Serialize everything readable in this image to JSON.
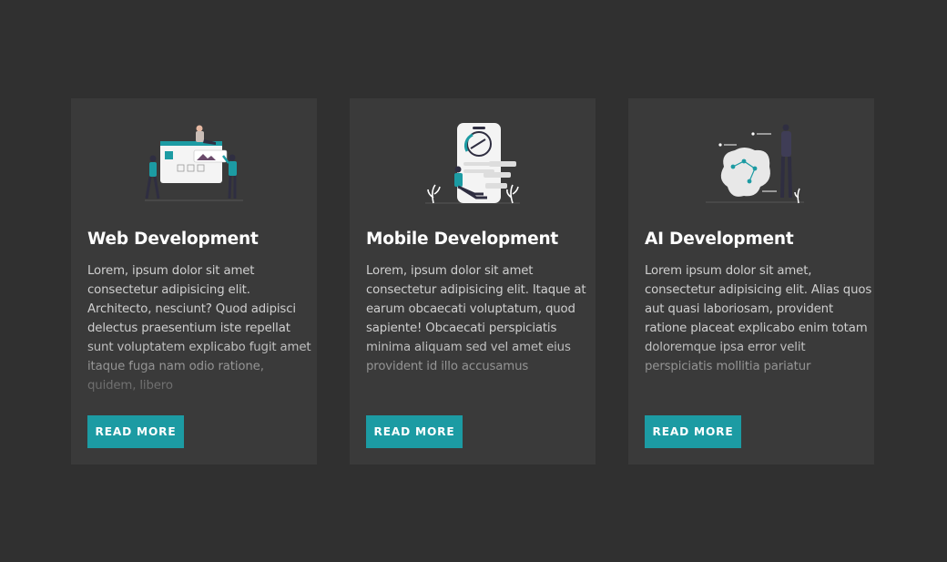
{
  "cards": [
    {
      "title": "Web Development",
      "body": "Lorem, ipsum dolor sit amet consectetur adipisicing elit. Architecto, nesciunt? Quod adipisci delectus praesentium iste repellat sunt voluptatem explicabo fugit amet itaque fuga nam odio ratione, quidem, libero",
      "button": "READ MORE",
      "illustration": "web-development-illustration"
    },
    {
      "title": "Mobile Development",
      "body": "Lorem, ipsum dolor sit amet consectetur adipisicing elit. Itaque at earum obcaecati voluptatum, quod sapiente! Obcaecati perspiciatis minima aliquam sed vel amet eius provident id illo accusamus",
      "button": "READ MORE",
      "illustration": "mobile-development-illustration"
    },
    {
      "title": "AI Development",
      "body": "Lorem ipsum dolor sit amet, consectetur adipisicing elit. Alias quos aut quasi laboriosam, provident ratione placeat explicabo enim totam doloremque ipsa error velit perspiciatis mollitia pariatur",
      "button": "READ MORE",
      "illustration": "ai-development-illustration"
    }
  ],
  "colors": {
    "page_background": "#303030",
    "card_background": "#3a3a3a",
    "accent": "#1c9ba3",
    "title_text": "#ffffff",
    "body_text": "#cfcfcf"
  }
}
